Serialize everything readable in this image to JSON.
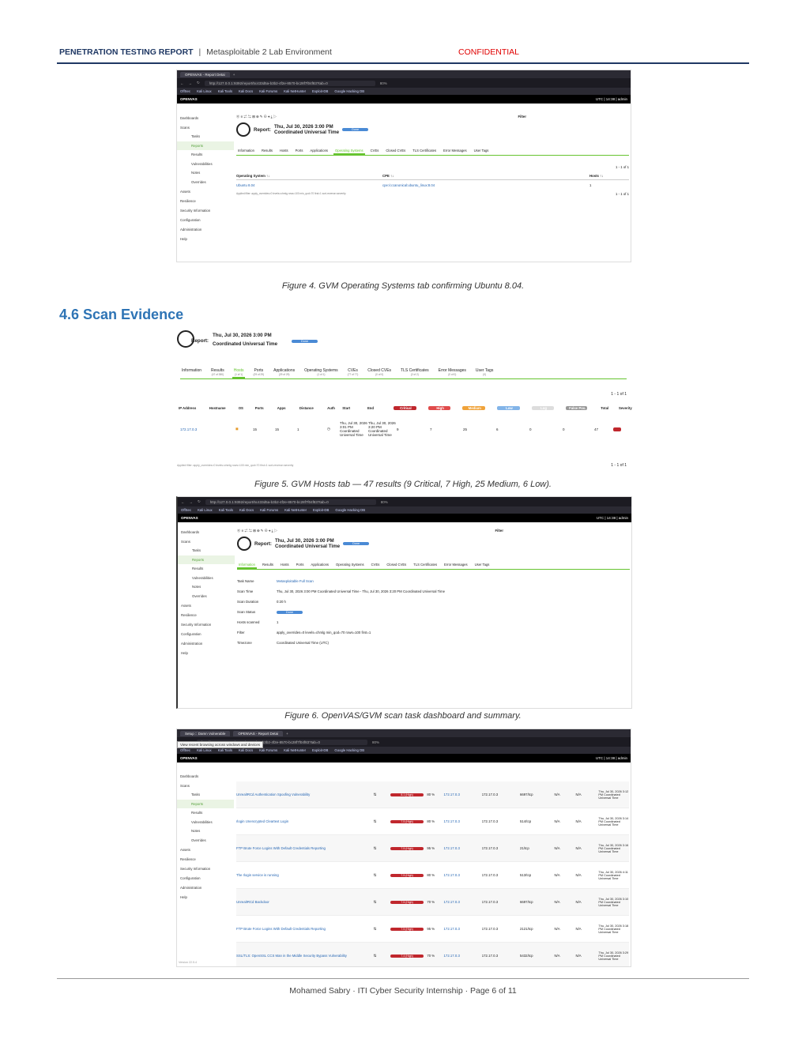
{
  "header": {
    "title": "PENETRATION TESTING REPORT",
    "separator": "|",
    "subtitle": "Metasploitable 2 Lab Environment",
    "classification": "CONFIDENTIAL"
  },
  "fig4": {
    "caption": "Figure 4. GVM Operating Systems tab confirming Ubuntu 8.04.",
    "browser_tab": "OPENVAS - Report Detai",
    "url": "http://127.0.0.1:9392/report/5c433d5a-b3b2-4f2e-8570-bc28f7f04f83?tab=0",
    "zoom": "80%",
    "bookmarks": [
      "OffSec",
      "Kali Linux",
      "Kali Tools",
      "Kali Docs",
      "Kali Forums",
      "Kali NetHunter",
      "Exploit-DB",
      "Google Hacking DB"
    ],
    "app": "OPENVAS",
    "topbar_right": "UTC  |  14:38  |  admin",
    "sidebar": [
      "Dashboards",
      "Scans",
      "Tasks",
      "Reports",
      "Results",
      "Vulnerabilities",
      "Notes",
      "Overrides",
      "Assets",
      "Resilience",
      "Security Information",
      "Configuration",
      "Administration",
      "Help"
    ],
    "filter_label": "Filter",
    "report_label": "Report:",
    "report_date": "Thu, Jul 30, 2026 3:00 PM",
    "report_tz": "Coordinated Universal Time",
    "status": "Done",
    "tabs": [
      "Information",
      "Results",
      "Hosts",
      "Ports",
      "Applications",
      "Operating Systems",
      "CVEs",
      "Closed CVEs",
      "TLS Certificates",
      "Error Messages",
      "User Tags"
    ],
    "pager": "1 - 1 of 1",
    "col_os": "Operating System ↑↓",
    "col_cpe": "CPE ↑↓",
    "col_hosts": "Hosts ↑↓",
    "os_name": "Ubuntu 8.04",
    "cpe": "cpe:/o:canonical:ubuntu_linux:8.04",
    "hosts_val": "1",
    "applied_filter": "Applied filter: apply_overrides=0 levels=chmlg rows=100 min_qod=70 first=1 sort-reverse=severity"
  },
  "section": {
    "title": "4.6 Scan Evidence"
  },
  "fig5": {
    "caption": "Figure 5. GVM Hosts tab — 47 results (9 Critical, 7 High, 25 Medium, 6 Low).",
    "report_label": "Report:",
    "report_date": "Thu, Jul 30, 2026 3:00 PM",
    "report_tz": "Coordinated Universal Time",
    "status": "Done",
    "tabs": [
      {
        "label": "Information",
        "count": ""
      },
      {
        "label": "Results",
        "count": "(47 of 380)"
      },
      {
        "label": "Hosts",
        "count": "(1 of 1)"
      },
      {
        "label": "Ports",
        "count": "(29 of 29)"
      },
      {
        "label": "Applications",
        "count": "(29 of 29)"
      },
      {
        "label": "Operating Systems",
        "count": "(1 of 1)"
      },
      {
        "label": "CVEs",
        "count": "(77 of 77)"
      },
      {
        "label": "Closed CVEs",
        "count": "(0 of 0)"
      },
      {
        "label": "TLS Certificates",
        "count": "(2 of 2)"
      },
      {
        "label": "Error Messages",
        "count": "(0 of 0)"
      },
      {
        "label": "User Tags",
        "count": "(0)"
      }
    ],
    "pager": "1 - 1 of 1",
    "columns": [
      "IP Address",
      "Hostname",
      "OS",
      "Ports",
      "Apps",
      "Distance",
      "Auth",
      "Start",
      "End",
      "Critical",
      "High",
      "Medium",
      "Low",
      "Log",
      "False Pos.",
      "Total",
      "Severity"
    ],
    "row": {
      "ip": "172.17.0.3",
      "ports": "15",
      "apps": "15",
      "distance": "1",
      "start": "Thu, Jul 30, 2026 3:01 PM Coordinated Universal Time",
      "end": "Thu, Jul 30, 2026 3:20 PM Coordinated Universal Time",
      "critical": "9",
      "high": "7",
      "medium": "25",
      "low": "6",
      "log": "0",
      "false_pos": "0",
      "total": "47"
    },
    "applied_filter": "Applied filter: apply_overrides=0 levels=chmlg rows=100 min_qod=70 first=1 sort-reverse=severity"
  },
  "fig6": {
    "caption": "Figure 6. OpenVAS/GVM scan task dashboard and summary.",
    "info": [
      {
        "k": "Task Name",
        "v": "Metasploitable Full Scan",
        "link": true
      },
      {
        "k": "Scan Time",
        "v": "Thu, Jul 30, 2026 3:00 PM Coordinated Universal Time - Thu, Jul 30, 2026 3:20 PM Coordinated Universal Time",
        "link": false
      },
      {
        "k": "Scan Duration",
        "v": "0:20 h",
        "link": false
      },
      {
        "k": "Scan Status",
        "v": "Done",
        "link": false
      },
      {
        "k": "Hosts scanned",
        "v": "1",
        "link": false
      },
      {
        "k": "Filter",
        "v": "apply_overrides=0 levels=chmlg min_qod=70 rows=100 first=1",
        "link": false
      },
      {
        "k": "Timezone",
        "v": "Coordinated Universal Time (UTC)",
        "link": false
      }
    ]
  },
  "fig7": {
    "browser_tabs": [
      "Setup :: Damn Vulnerable",
      "OPENVAS - Report Detai"
    ],
    "tooltip": "View recent browsing across windows and devices",
    "results": [
      {
        "name": "UnrealIRCd Authentication Spoofing Vulnerability",
        "sev": "8.1 (High)",
        "qod": "80 %",
        "host": "172.17.0.3",
        "loc": "6697/tcp",
        "date": "Thu, Jul 30, 2026 3:12 PM Coordinated Universal Time"
      },
      {
        "name": "rlogin Unencrypted Cleartext Login",
        "sev": "7.5 (High)",
        "qod": "80 %",
        "host": "172.17.0.3",
        "loc": "514/tcp",
        "date": "Thu, Jul 30, 2026 3:14 PM Coordinated Universal Time"
      },
      {
        "name": "FTP Brute Force Logins With Default Credentials Reporting",
        "sev": "7.5 (High)",
        "qod": "95 %",
        "host": "172.17.0.3",
        "loc": "21/tcp",
        "date": "Thu, Jul 30, 2026 3:16 PM Coordinated Universal Time"
      },
      {
        "name": "The rlogin service is running",
        "sev": "7.5 (High)",
        "qod": "80 %",
        "host": "172.17.0.3",
        "loc": "513/tcp",
        "date": "Thu, Jul 30, 2026 4:11 PM Coordinated Universal Time"
      },
      {
        "name": "UnrealIRCd Backdoor",
        "sev": "7.5 (High)",
        "qod": "70 %",
        "host": "172.17.0.3",
        "loc": "6697/tcp",
        "date": "Thu, Jul 30, 2026 3:10 PM Coordinated Universal Time"
      },
      {
        "name": "FTP Brute Force Logins With Default Credentials Reporting",
        "sev": "7.5 (High)",
        "qod": "95 %",
        "host": "172.17.0.3",
        "loc": "2121/tcp",
        "date": "Thu, Jul 30, 2026 3:18 PM Coordinated Universal Time"
      },
      {
        "name": "SSL/TLS: OpenSSL CCS Man in the Middle Security Bypass Vulnerability",
        "sev": "7.4 (High)",
        "qod": "70 %",
        "host": "172.17.0.3",
        "loc": "5432/tcp",
        "date": "Thu, Jul 30, 2026 3:29 PM Coordinated Universal Time"
      }
    ],
    "na": "N/A",
    "version": "Version 22.5.4"
  },
  "footer": {
    "text": "Mohamed Sabry  ·  ITI Cyber Security Internship  ·  Page 6 of 11"
  }
}
